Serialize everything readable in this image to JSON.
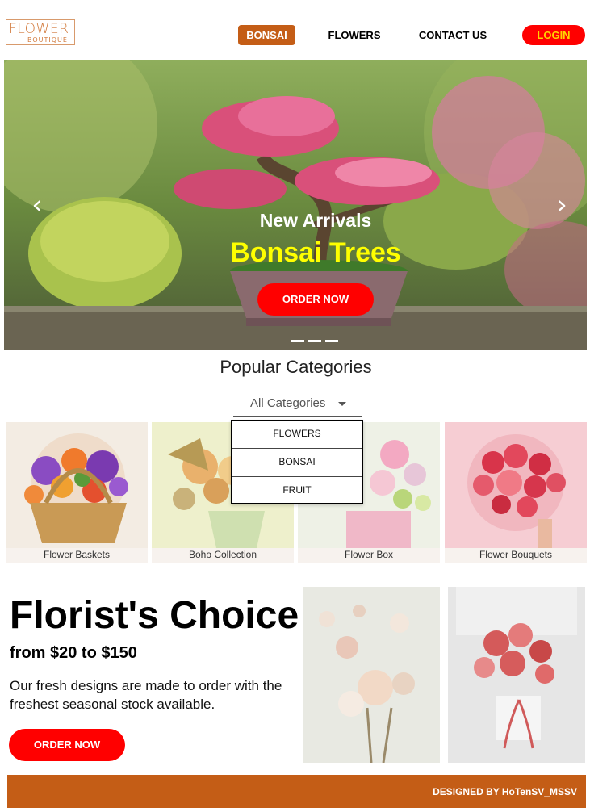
{
  "brand": {
    "logo_line1": "FLOWER",
    "logo_line2": "BOUTIQUE",
    "color": "#c45d16"
  },
  "nav": {
    "items": [
      "BONSAI",
      "FLOWERS",
      "CONTACT US"
    ],
    "active": "BONSAI",
    "login": "LOGIN"
  },
  "hero": {
    "kicker": "New Arrivals",
    "title": "Bonsai Trees",
    "cta": "ORDER NOW",
    "prev_icon": "chevron-left-icon",
    "next_icon": "chevron-right-icon",
    "slides": 3
  },
  "categories": {
    "heading": "Popular Categories",
    "filter_label": "All Categories",
    "dropdown_options": [
      "FLOWERS",
      "BONSAI",
      "FRUIT"
    ],
    "cards": [
      {
        "caption": "Flower Baskets"
      },
      {
        "caption": "Boho Collection"
      },
      {
        "caption": "Flower Box"
      },
      {
        "caption": "Flower Bouquets"
      }
    ]
  },
  "promo": {
    "title": "Florist's Choice",
    "price": "from $20 to $150",
    "description": "Our fresh designs are made to order with the freshest seasonal stock available.",
    "cta": "ORDER NOW"
  },
  "footer": {
    "credit": "DESIGNED BY HoTenSV_MSSV"
  },
  "colors": {
    "accent": "#c45d16",
    "red": "#ff0000",
    "yellow": "#ffff00",
    "login_text": "#ffd400"
  }
}
